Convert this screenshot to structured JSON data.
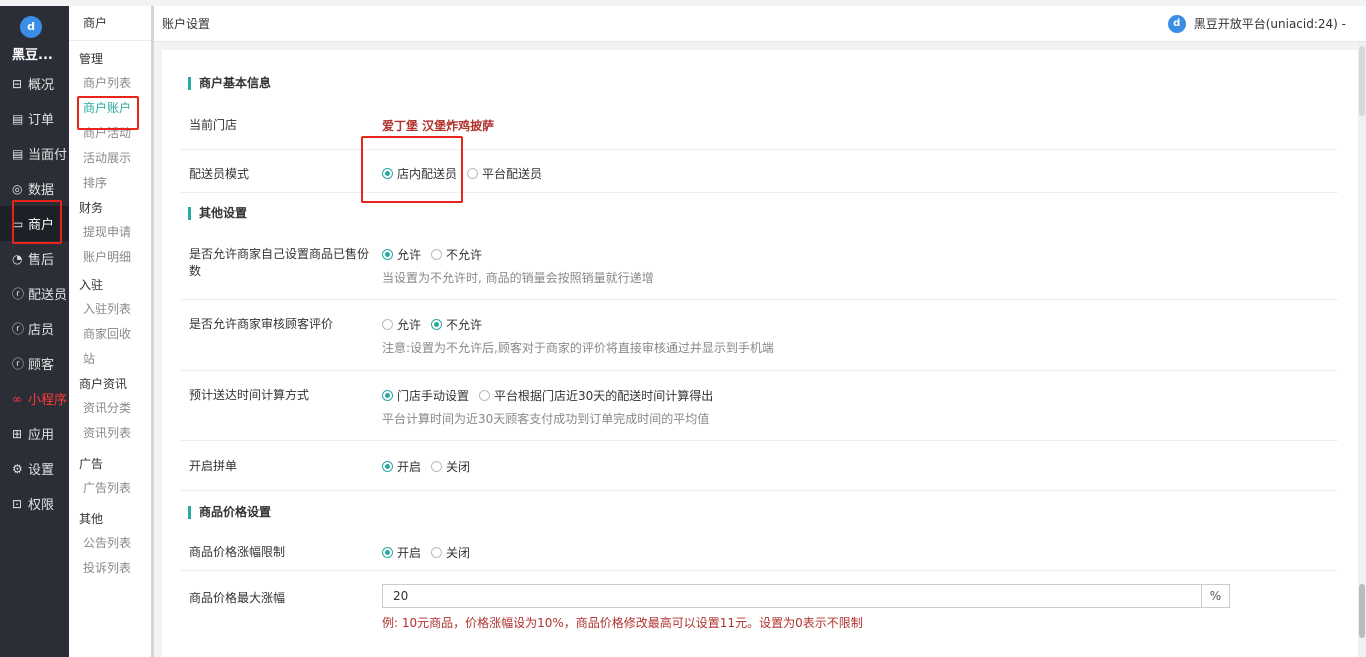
{
  "sidebar": {
    "brand": "黑豆...",
    "logo_letter": "d",
    "items": [
      {
        "icon": "grid-icon",
        "glyph": "⊟",
        "label": "概况"
      },
      {
        "icon": "list-icon",
        "glyph": "▤",
        "label": "订单"
      },
      {
        "icon": "receipt-icon",
        "glyph": "▤",
        "label": "当面付"
      },
      {
        "icon": "chart-icon",
        "glyph": "◎",
        "label": "数据"
      },
      {
        "icon": "store-icon",
        "glyph": "▭",
        "label": "商户"
      },
      {
        "icon": "service-icon",
        "glyph": "◔",
        "label": "售后"
      },
      {
        "icon": "courier-icon",
        "glyph": "ⓡ",
        "label": "配送员"
      },
      {
        "icon": "clerk-icon",
        "glyph": "ⓡ",
        "label": "店员"
      },
      {
        "icon": "customer-icon",
        "glyph": "ⓡ",
        "label": "顾客"
      },
      {
        "icon": "miniprogram-icon",
        "glyph": "∞",
        "label": "小程序"
      },
      {
        "icon": "apps-icon",
        "glyph": "⊞",
        "label": "应用"
      },
      {
        "icon": "gear-icon",
        "glyph": "⚙",
        "label": "设置"
      },
      {
        "icon": "lock-icon",
        "glyph": "⊡",
        "label": "权限"
      }
    ]
  },
  "submenu": {
    "title": "商户",
    "groups": [
      {
        "title": "管理",
        "items": [
          "商户列表",
          "商户账户",
          "商户活动",
          "活动展示",
          "排序"
        ]
      },
      {
        "title": "财务",
        "items": [
          "提现申请",
          "账户明细"
        ]
      },
      {
        "title": "入驻",
        "items": [
          "入驻列表",
          "商家回收",
          "站"
        ]
      },
      {
        "title": "商户资讯",
        "items": [
          "资讯分类",
          "资讯列表"
        ]
      },
      {
        "title": "广告",
        "items": [
          "广告列表"
        ]
      },
      {
        "title": "其他",
        "items": [
          "公告列表",
          "投诉列表"
        ]
      }
    ]
  },
  "header": {
    "breadcrumb": "账户设置",
    "platform_name": "黑豆开放平台(uniacid:24) -",
    "platform_logo_letter": "d"
  },
  "form": {
    "sections": {
      "basic": "商户基本信息",
      "other": "其他设置",
      "price": "商品价格设置"
    },
    "current_store": {
      "label": "当前门店",
      "value": "爱丁堡 汉堡炸鸡披萨"
    },
    "courier_mode": {
      "label": "配送员模式",
      "options": [
        "店内配送员",
        "平台配送员"
      ],
      "selected": 0
    },
    "allow_sold_count": {
      "label": "是否允许商家自己设置商品已售份数",
      "options": [
        "允许",
        "不允许"
      ],
      "selected": 0,
      "hint": "当设置为不允许时, 商品的销量会按照销量就行递增"
    },
    "allow_review_audit": {
      "label": "是否允许商家审核顾客评价",
      "options": [
        "允许",
        "不允许"
      ],
      "selected": 1,
      "hint": "注意:设置为不允许后,顾客对于商家的评价将直接审核通过并显示到手机端"
    },
    "delivery_time_calc": {
      "label": "预计送达时间计算方式",
      "options": [
        "门店手动设置",
        "平台根据门店近30天的配送时间计算得出"
      ],
      "selected": 0,
      "hint": "平台计算时间为近30天顾客支付成功到订单完成时间的平均值"
    },
    "group_buy": {
      "label": "开启拼单",
      "options": [
        "开启",
        "关闭"
      ],
      "selected": 0
    },
    "price_limit": {
      "label": "商品价格涨幅限制",
      "options": [
        "开启",
        "关闭"
      ],
      "selected": 0
    },
    "max_increase": {
      "label": "商品价格最大涨幅",
      "value": "20",
      "unit": "%",
      "hint": "例: 10元商品，价格涨幅设为10%，商品价格修改最高可以设置11元。设置为0表示不限制"
    }
  }
}
